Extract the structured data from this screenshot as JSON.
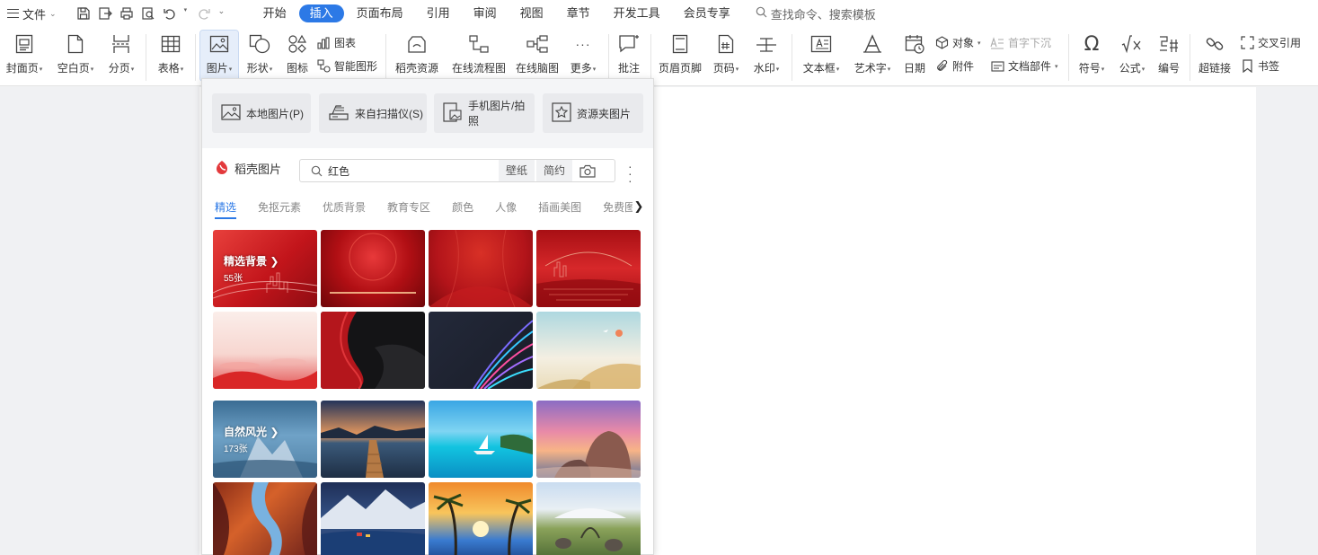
{
  "menubar": {
    "file_label": "文件",
    "tabs": [
      "开始",
      "插入",
      "页面布局",
      "引用",
      "审阅",
      "视图",
      "章节",
      "开发工具",
      "会员专享"
    ],
    "active_tab": "插入",
    "search_placeholder": "查找命令、搜索模板"
  },
  "ribbon": {
    "cover": "封面页",
    "blank": "空白页",
    "pagebreak": "分页",
    "table": "表格",
    "picture": "图片",
    "shape": "形状",
    "icon": "图标",
    "chart": "图表",
    "smartart": "智能图形",
    "daoke": "稻壳资源",
    "flowchart": "在线流程图",
    "mindmap": "在线脑图",
    "more": "更多",
    "comment": "批注",
    "header_footer": "页眉页脚",
    "page_num": "页码",
    "watermark": "水印",
    "textbox": "文本框",
    "wordart": "艺术字",
    "date": "日期",
    "object": "对象",
    "attachment": "附件",
    "dropcap": "首字下沉",
    "docpart": "文档部件",
    "symbol": "符号",
    "formula": "公式",
    "numbering": "编号",
    "hyperlink": "超链接",
    "crossref": "交叉引用",
    "bookmark": "书签"
  },
  "panel": {
    "sources": [
      "本地图片(P)",
      "来自扫描仪(S)",
      "手机图片/拍照",
      "资源夹图片"
    ],
    "daoke_title": "稻壳图片",
    "search_value": "红色",
    "search_chips": [
      "壁纸",
      "简约"
    ],
    "categories": [
      "精选",
      "免抠元素",
      "优质背景",
      "教育专区",
      "颜色",
      "人像",
      "插画美图",
      "免费图"
    ],
    "active_category": "精选",
    "section1": {
      "title": "精选背景",
      "count": "55张"
    },
    "section2": {
      "title": "自然风光",
      "count": "173张"
    }
  },
  "colors": {
    "accent": "#2c79e6",
    "brand_red": "#e3393c"
  }
}
